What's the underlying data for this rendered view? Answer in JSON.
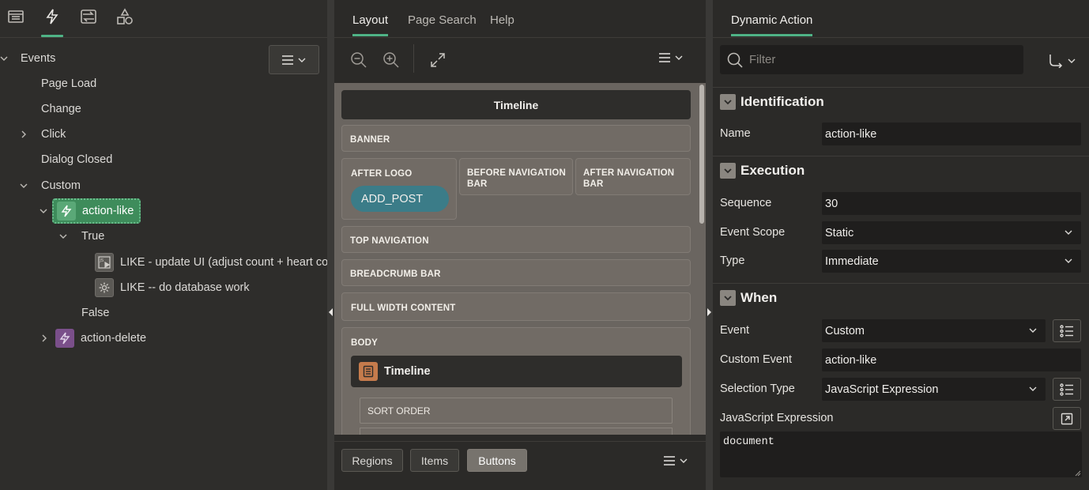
{
  "left": {
    "tabs": [
      {
        "icon": "rendering-icon"
      },
      {
        "icon": "dynamic-actions-icon",
        "active": true
      },
      {
        "icon": "processing-icon"
      },
      {
        "icon": "shared-components-icon"
      }
    ],
    "tree": {
      "events_label": "Events",
      "page_load": "Page Load",
      "change": "Change",
      "click": "Click",
      "dialog_closed": "Dialog Closed",
      "custom": "Custom",
      "action_like": "action-like",
      "true_label": "True",
      "like_update": "LIKE - update UI (adjust count + heart colo",
      "like_db": "LIKE -- do database work",
      "false_label": "False",
      "action_delete": "action-delete"
    }
  },
  "middle": {
    "tabs": [
      "Layout",
      "Page Search",
      "Help"
    ],
    "active_tab": "Layout",
    "canvas": {
      "title": "Timeline",
      "banner": "BANNER",
      "after_logo": "AFTER LOGO",
      "before_nav_bar": "BEFORE NAVIGATION BAR",
      "after_nav_bar": "AFTER NAVIGATION BAR",
      "add_post": "ADD_POST",
      "top_navigation": "TOP NAVIGATION",
      "breadcrumb_bar": "BREADCRUMB BAR",
      "full_width_content": "FULL WIDTH CONTENT",
      "body": "BODY",
      "body_region": "Timeline",
      "sort_order": "SORT ORDER"
    },
    "bottom_tabs": [
      "Regions",
      "Items",
      "Buttons"
    ],
    "bottom_active": "Buttons"
  },
  "right": {
    "tab": "Dynamic Action",
    "filter_placeholder": "Filter",
    "sections": {
      "identification": "Identification",
      "execution": "Execution",
      "when": "When"
    },
    "fields": {
      "name_label": "Name",
      "name_value": "action-like",
      "sequence_label": "Sequence",
      "sequence_value": "30",
      "event_scope_label": "Event Scope",
      "event_scope_value": "Static",
      "type_label": "Type",
      "type_value": "Immediate",
      "event_label": "Event",
      "event_value": "Custom",
      "custom_event_label": "Custom Event",
      "custom_event_value": "action-like",
      "selection_type_label": "Selection Type",
      "selection_type_value": "JavaScript Expression",
      "js_expr_label": "JavaScript Expression",
      "js_expr_value": "document"
    }
  },
  "colors": {
    "accent": "#4fb386",
    "selected_node": "#3e8c5b",
    "button_chip": "#3b7c88",
    "delete_icon": "#7a4f8a"
  }
}
